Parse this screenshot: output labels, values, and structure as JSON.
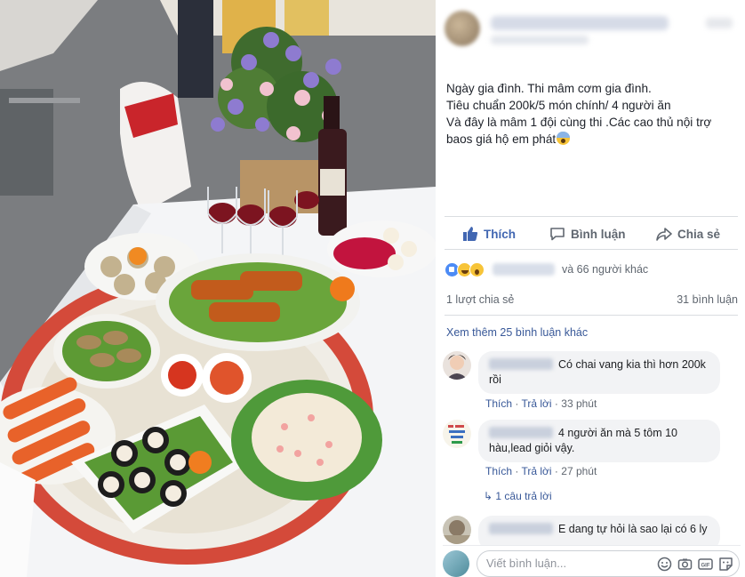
{
  "post": {
    "lines": [
      "Ngày gia đình. Thi mâm cơm gia đình.",
      "Tiêu chuẩn 200k/5 món chính/ 4 người ăn",
      "Và đây là mâm 1 đội cùng thi .Các cao thủ nội trợ",
      "baos giá hộ em phát"
    ]
  },
  "actions": {
    "like": "Thích",
    "comment": "Bình luận",
    "share": "Chia sẻ"
  },
  "reactions": {
    "text": "và 66 người khác"
  },
  "counts": {
    "shares": "1 lượt chia sẻ",
    "comments": "31 bình luận"
  },
  "view_more": "Xem thêm 25 bình luận khác",
  "comments": [
    {
      "text_line1": "Có chai vang kia thì hơn 200k",
      "text_line2": "rồi",
      "like": "Thích",
      "reply": "Trả lời",
      "time": "33 phút"
    },
    {
      "text_line1": "4 người ăn mà 5 tôm 10",
      "text_line2": "hàu,lead giỏi vậy.",
      "like": "Thích",
      "reply": "Trả lời",
      "time": "27 phút",
      "replies": "1 câu trả lời"
    },
    {
      "text_line1": "E dang tự hỏi là sao lại có 6 ly"
    }
  ],
  "composer": {
    "placeholder": "Viết bình luận...",
    "gif": "GIF"
  }
}
